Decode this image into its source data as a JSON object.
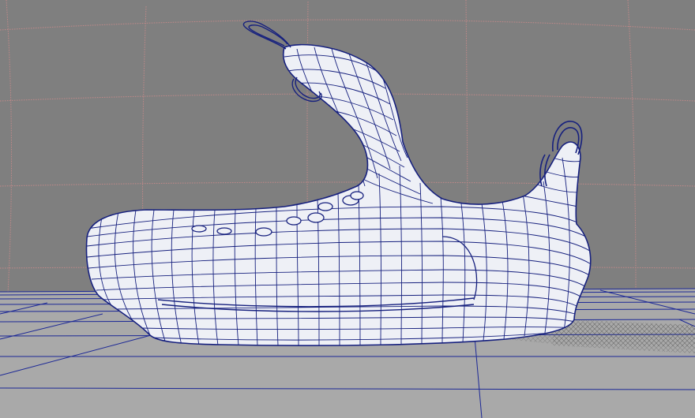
{
  "viewport": {
    "kind": "3d-modeling-viewport",
    "view": "perspective",
    "display_mode": "wireframe-on-shaded",
    "object": "sneaker mesh",
    "colors": {
      "background": "#7f7f7f",
      "grid_wall": "#c98a8a",
      "ground_lines": "#1c2896",
      "ground_fill": "#a9a9a9",
      "mesh_fill": "#eef0f6",
      "mesh_wire": "#16207e"
    }
  }
}
